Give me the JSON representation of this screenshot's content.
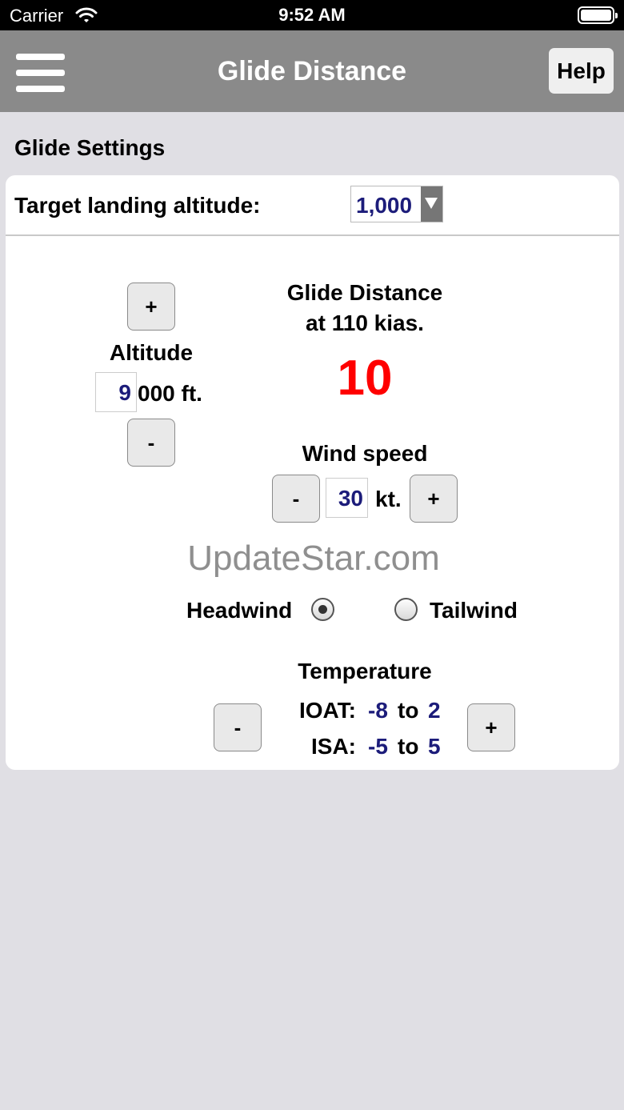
{
  "status_bar": {
    "carrier": "Carrier",
    "time": "9:52 AM"
  },
  "navbar": {
    "title": "Glide Distance",
    "help_label": "Help"
  },
  "section_title": "Glide Settings",
  "target": {
    "label": "Target landing altitude:",
    "selected": "1,000"
  },
  "altitude": {
    "plus_label": "+",
    "label": "Altitude",
    "digit": "9",
    "suffix": "000 ft.",
    "minus_label": "-"
  },
  "glide": {
    "line1": "Glide Distance",
    "line2": "at 110 kias.",
    "value": "10"
  },
  "wind": {
    "label": "Wind speed",
    "minus_label": "-",
    "value": "30",
    "unit": "kt.",
    "plus_label": "+",
    "headwind_label": "Headwind",
    "tailwind_label": "Tailwind",
    "selected": "Headwind"
  },
  "watermark": "UpdateStar.com",
  "temperature": {
    "label": "Temperature",
    "minus_label": "-",
    "plus_label": "+",
    "ioat_label": "IOAT:",
    "ioat_low": "-8",
    "ioat_to": "to",
    "ioat_high": "2",
    "isa_label": "ISA:",
    "isa_low": "-5",
    "isa_to": "to",
    "isa_high": "5"
  },
  "colors": {
    "navbar": "#8a8a8a",
    "value_blue": "#1c1c7a",
    "glide_red": "#ff0000"
  }
}
